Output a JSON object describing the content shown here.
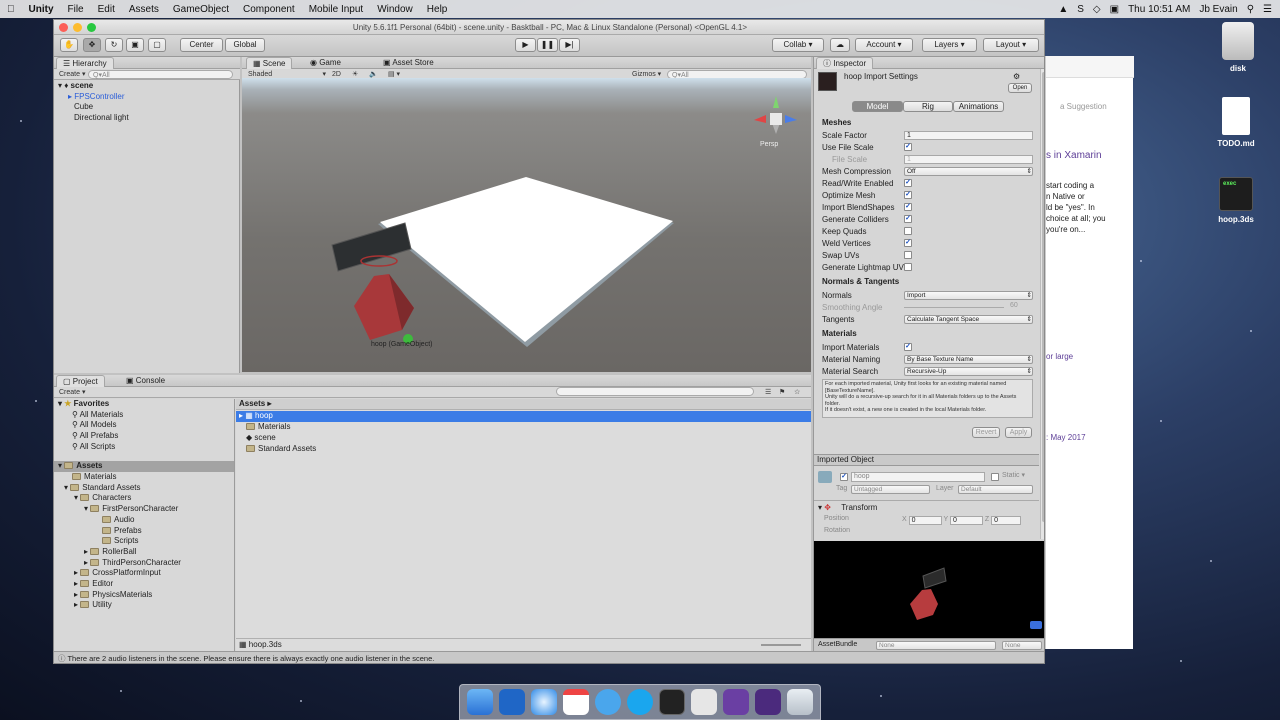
{
  "menubar": {
    "app": "Unity",
    "items": [
      "File",
      "Edit",
      "Assets",
      "GameObject",
      "Component",
      "Mobile Input",
      "Window",
      "Help"
    ],
    "clock": "Thu 10:51 AM",
    "user": "Jb Evain"
  },
  "desktop": {
    "disk": "disk",
    "todo": "TODO.md",
    "hoop": "hoop.3ds",
    "exec": "exec"
  },
  "browser": {
    "suggestion": "a Suggestion",
    "xamarin": "s in Xamarin",
    "p1": "start coding a",
    "p2": "n Native or",
    "p3": "ld be \"yes\". In",
    "p4": "choice at all; you",
    "p5": "you're on...",
    "large": "or large",
    "may": ": May 2017"
  },
  "window": {
    "title": "Unity 5.6.1f1 Personal (64bit) - scene.unity - Basktball - PC, Mac & Linux Standalone (Personal) <OpenGL 4.1>"
  },
  "toolbar": {
    "center": "Center",
    "global": "Global",
    "collab": "Collab",
    "account": "Account",
    "layers": "Layers",
    "layout": "Layout"
  },
  "hierarchy": {
    "tab": "Hierarchy",
    "create": "Create",
    "search": "Q▾All",
    "scene": "scene",
    "items": [
      "FPSController",
      "Cube",
      "Directional light"
    ]
  },
  "sceneview": {
    "tabs": [
      "Scene",
      "Game",
      "Asset Store"
    ],
    "shaded": "Shaded",
    "twod": "2D",
    "gizmos": "Gizmos",
    "search": "Q▾All",
    "persp": "Persp",
    "label": "hoop (GameObject)"
  },
  "project": {
    "tabs": [
      "Project",
      "Console"
    ],
    "create": "Create",
    "favorites": "Favorites",
    "fav_items": [
      "All Materials",
      "All Models",
      "All Prefabs",
      "All Scripts"
    ],
    "assets": "Assets",
    "tree": [
      "Materials",
      "Standard Assets",
      "Characters",
      "FirstPersonCharacter",
      "Audio",
      "Prefabs",
      "Scripts",
      "RollerBall",
      "ThirdPersonCharacter",
      "CrossPlatformInput",
      "Editor",
      "PhysicsMaterials",
      "Utility"
    ],
    "crumb": "Assets",
    "files": [
      "hoop",
      "Materials",
      "scene",
      "Standard Assets"
    ],
    "footer": "hoop.3ds"
  },
  "inspector": {
    "tab": "Inspector",
    "title": "hoop Import Settings",
    "open": "Open",
    "tabs": [
      "Model",
      "Rig",
      "Animations"
    ],
    "meshes": "Meshes",
    "scale_factor": "Scale Factor",
    "scale_value": "1",
    "use_file_scale": "Use File Scale",
    "file_scale": "File Scale",
    "file_scale_value": "1",
    "mesh_compression": "Mesh Compression",
    "mesh_compression_value": "Off",
    "rw": "Read/Write Enabled",
    "optimize": "Optimize Mesh",
    "blendshapes": "Import BlendShapes",
    "colliders": "Generate Colliders",
    "quads": "Keep Quads",
    "weld": "Weld Vertices",
    "swap": "Swap UVs",
    "lightmap": "Generate Lightmap UVs",
    "normals_head": "Normals & Tangents",
    "normals": "Normals",
    "normals_value": "Import",
    "smoothing": "Smoothing Angle",
    "smoothing_value": "60",
    "tangents": "Tangents",
    "tangents_value": "Calculate Tangent Space",
    "materials_head": "Materials",
    "import_materials": "Import Materials",
    "naming": "Material Naming",
    "naming_value": "By Base Texture Name",
    "search": "Material Search",
    "search_value": "Recursive-Up",
    "help": "For each imported material, Unity first looks for an existing material named [BaseTextureName].\nUnity will do a recursive-up search for it in all Materials folders up to the Assets folder.\nIf it doesn't exist, a new one is created in the local Materials folder.",
    "revert": "Revert",
    "apply": "Apply",
    "imported_object": "Imported Object",
    "obj_name": "hoop",
    "static": "Static",
    "tag": "Tag",
    "tag_value": "Untagged",
    "layer": "Layer",
    "layer_value": "Default",
    "transform": "Transform",
    "position": "Position",
    "rotation": "Rotation",
    "x": "X",
    "y": "Y",
    "z": "Z",
    "zero": "0",
    "assetbundle": "AssetBundle",
    "none": "None"
  },
  "status": "There are 2 audio listeners in the scene. Please ensure there is always exactly one audio listener in the scene."
}
